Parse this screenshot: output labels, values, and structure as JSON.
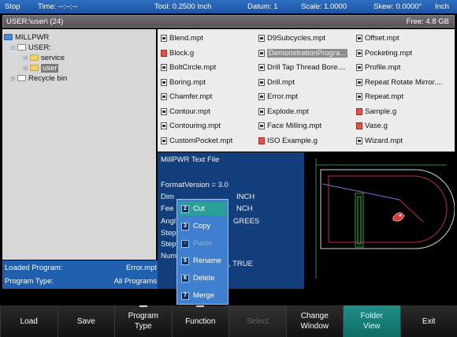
{
  "status": {
    "mode": "Stop",
    "time": "Time:  --:--:--",
    "tool": "Tool: 0.2500 Inch",
    "datum": "Datum: 1",
    "scale": "Scale: 1.0000",
    "skew": "Skew: 0.0000°",
    "units": "Inch"
  },
  "path": {
    "current": "USER:\\user\\ (24)",
    "free": "Free: 4.8 GB"
  },
  "tree": {
    "root": "MILLPWR",
    "user": "USER:",
    "service": "service",
    "user_folder": "user",
    "recycle": "Recycle bin"
  },
  "files": [
    {
      "name": "Blend.mpt",
      "type": "mpt"
    },
    {
      "name": "Block.g",
      "type": "g"
    },
    {
      "name": "BoltCircle.mpt",
      "type": "mpt"
    },
    {
      "name": "Boring.mpt",
      "type": "mpt"
    },
    {
      "name": "Chamfer.mpt",
      "type": "mpt"
    },
    {
      "name": "Contour.mpt",
      "type": "mpt"
    },
    {
      "name": "Contouring.mpt",
      "type": "mpt"
    },
    {
      "name": "CustomPocket.mpt",
      "type": "mpt"
    },
    {
      "name": "D9Subcycles.mpt",
      "type": "mpt"
    },
    {
      "name": "DemonstrationProgra...",
      "type": "mpt",
      "selected": true
    },
    {
      "name": "Drill Tap Thread Bore....",
      "type": "mpt"
    },
    {
      "name": "Drill.mpt",
      "type": "mpt"
    },
    {
      "name": "Error.mpt",
      "type": "mpt"
    },
    {
      "name": "Explode.mpt",
      "type": "mpt"
    },
    {
      "name": "Face Milling.mpt",
      "type": "mpt"
    },
    {
      "name": "ISO Example.g",
      "type": "g"
    },
    {
      "name": "Offset.mpt",
      "type": "mpt"
    },
    {
      "name": "Pocketing.mpt",
      "type": "mpt"
    },
    {
      "name": "Profile.mpt",
      "type": "mpt"
    },
    {
      "name": "Repeat Rotate Mirror....",
      "type": "mpt"
    },
    {
      "name": "Repeat.mpt",
      "type": "mpt"
    },
    {
      "name": "Sample.g",
      "type": "g"
    },
    {
      "name": "Vase.g",
      "type": "g"
    },
    {
      "name": "Wizard.mpt",
      "type": "mpt"
    }
  ],
  "preview": {
    "line1": "MillPWR Text File",
    "line2": "FormatVersion = 3.0",
    "line3a": "Dim",
    "line3b": "INCH",
    "line4a": "Fee",
    "line4b": "NCH",
    "line5a": "Angl",
    "line5b": "GREES",
    "line6a": "Step",
    "line7a": "Step",
    "line8a": "Num",
    "line8b": ", TRUE"
  },
  "info": {
    "loaded_label": "Loaded Program:",
    "loaded_value": "Error.mpt",
    "type_label": "Program Type:",
    "type_value": "All Programs"
  },
  "menu": [
    {
      "num": "2",
      "label": "Cut",
      "state": "active"
    },
    {
      "num": "3",
      "label": "Copy",
      "state": "normal"
    },
    {
      "num": "4",
      "label": "Paste",
      "state": "disabled"
    },
    {
      "num": "5",
      "label": "Rename",
      "state": "normal"
    },
    {
      "num": "6",
      "label": "Delete",
      "state": "normal"
    },
    {
      "num": "7",
      "label": "Merge",
      "state": "normal"
    }
  ],
  "softkeys": [
    {
      "l1": "Load",
      "l2": "",
      "state": "normal",
      "tick": false
    },
    {
      "l1": "Save",
      "l2": "",
      "state": "normal",
      "tick": false
    },
    {
      "l1": "Program",
      "l2": "Type",
      "state": "normal",
      "tick": true
    },
    {
      "l1": "Function",
      "l2": "",
      "state": "normal",
      "tick": true
    },
    {
      "l1": "Select",
      "l2": "",
      "state": "disabled",
      "tick": false
    },
    {
      "l1": "Change",
      "l2": "Window",
      "state": "normal",
      "tick": false
    },
    {
      "l1": "Folder",
      "l2": "View",
      "state": "active",
      "tick": false
    },
    {
      "l1": "Exit",
      "l2": "",
      "state": "normal",
      "tick": false
    }
  ],
  "colors": {
    "statusbar": "#1d56a6",
    "panel_blue": "#1f5fae",
    "preview_blue": "#123f7b",
    "menu_blue": "#3e7fd0",
    "active_teal": "#2aa198"
  }
}
